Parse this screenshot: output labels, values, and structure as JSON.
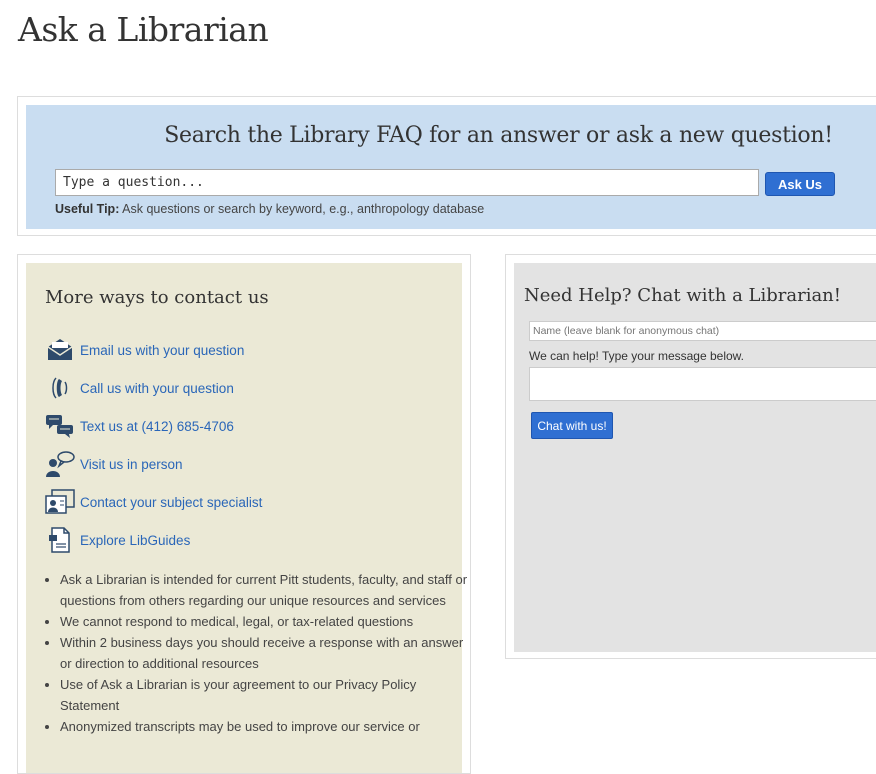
{
  "page": {
    "title": "Ask a Librarian"
  },
  "search": {
    "heading": "Search the Library FAQ for an answer or ask a new question!",
    "input_value": "Type a question...",
    "button_label": "Ask Us",
    "tip_label": "Useful Tip:",
    "tip_text": "Ask questions or search by keyword, e.g., anthropology database"
  },
  "contact": {
    "heading": "More ways to contact us",
    "links": [
      {
        "label": "Email us with your question",
        "icon": "envelope-icon"
      },
      {
        "label": "Call us with your question",
        "icon": "phone-icon"
      },
      {
        "label": "Text us at (412) 685-4706",
        "icon": "text-message-icon"
      },
      {
        "label": "Visit us in person",
        "icon": "person-speech-icon"
      },
      {
        "label": "Contact your subject specialist",
        "icon": "id-card-icon"
      },
      {
        "label": "Explore LibGuides",
        "icon": "document-icon"
      }
    ],
    "notes": [
      "Ask a Librarian is intended for current Pitt students, faculty, and staff or questions from others regarding our unique resources and services",
      "We cannot respond to medical, legal, or tax-related questions",
      "Within 2 business days you should receive a response with an answer or direction to additional resources",
      "Use of Ask a Librarian is your agreement to our Privacy Policy Statement",
      "Anonymized transcripts may be used to improve our service or"
    ]
  },
  "chat": {
    "heading": "Need Help? Chat with a Librarian!",
    "name_placeholder": "Name (leave blank for anonymous chat)",
    "help_text": "We can help! Type your message below.",
    "button_label": "Chat with us!"
  },
  "colors": {
    "search_bg": "#c9ddf1",
    "contact_bg": "#ebe9d6",
    "chat_bg": "#e3e3e3",
    "button": "#2f6fd2",
    "link": "#2a66b8",
    "icon": "#2e4a6b"
  }
}
